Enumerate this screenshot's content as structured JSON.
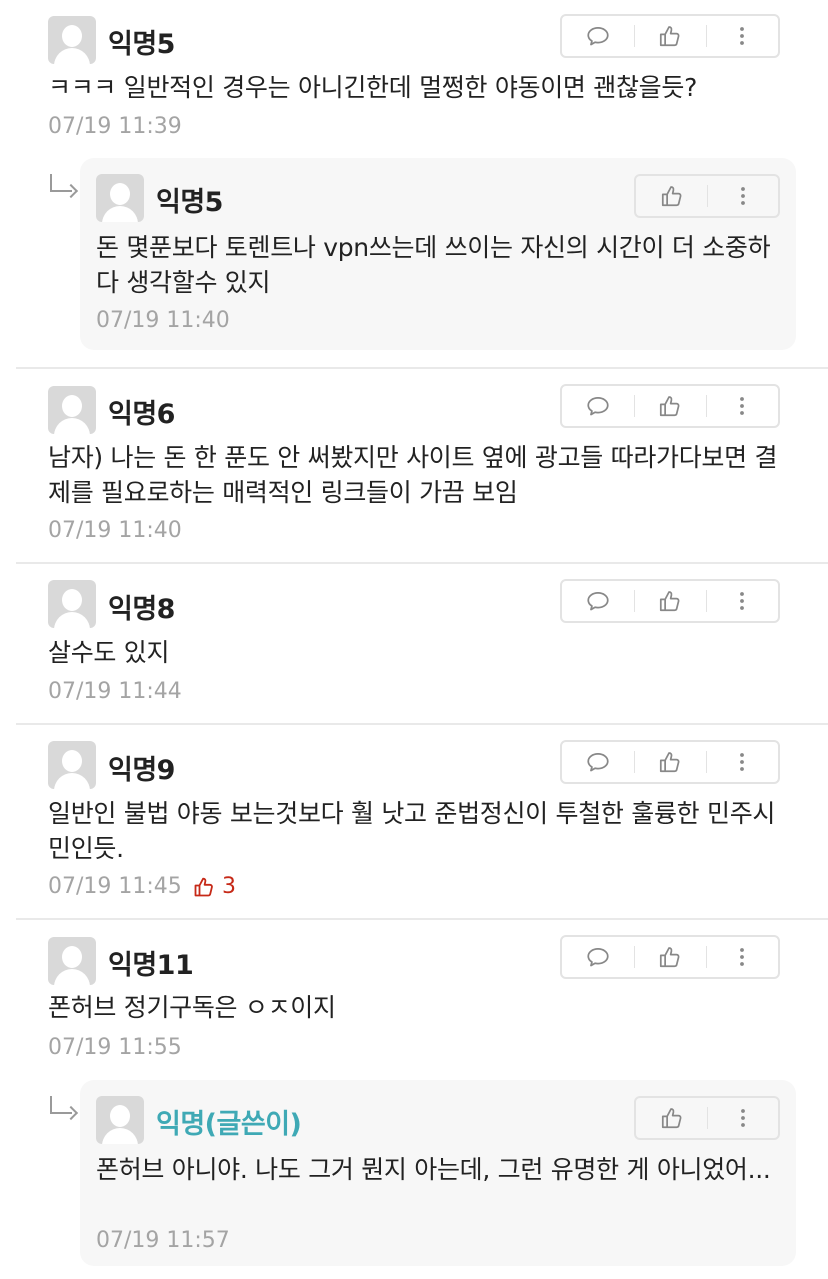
{
  "comments": [
    {
      "nick": "익명5",
      "text": "ㅋㅋㅋ 일반적인 경우는 아니긴한데 멀쩡한 야동이면 괜찮을듯?",
      "time": "07/19 11:39"
    },
    {
      "nick": "익명5",
      "text": "돈 몇푼보다 토렌트나 vpn쓰는데 쓰이는 자신의 시간이 더 소중하다 생각할수 있지",
      "time": "07/19 11:40"
    },
    {
      "nick": "익명6",
      "text": "남자) 나는 돈 한 푼도 안 써봤지만 사이트 옆에 광고들 따라가다보면 결제를 필요로하는 매력적인 링크들이 가끔 보임",
      "time": "07/19 11:40"
    },
    {
      "nick": "익명8",
      "text": "살수도 있지",
      "time": "07/19 11:44"
    },
    {
      "nick": "익명9",
      "text": "일반인 불법 야동 보는것보다 훨 낫고 준법정신이 투철한 훌륭한 민주시민인듯.",
      "time": "07/19 11:45",
      "likes": "3"
    },
    {
      "nick": "익명11",
      "text": "폰허브 정기구독은 ㅇㅈ이지",
      "time": "07/19 11:55"
    },
    {
      "nick": "익명(글쓴이)",
      "text": "폰허브 아니야. 나도 그거 뭔지 아는데, 그런 유명한 게 아니었어...",
      "time": "07/19 11:57"
    }
  ],
  "icons": {
    "reply": "speech-bubble-icon",
    "like": "thumbs-up-icon",
    "more": "vertical-dots-icon"
  },
  "colors": {
    "author": "#3fa9b5",
    "likes": "#c62917",
    "timestamp": "#a4a4a4"
  }
}
